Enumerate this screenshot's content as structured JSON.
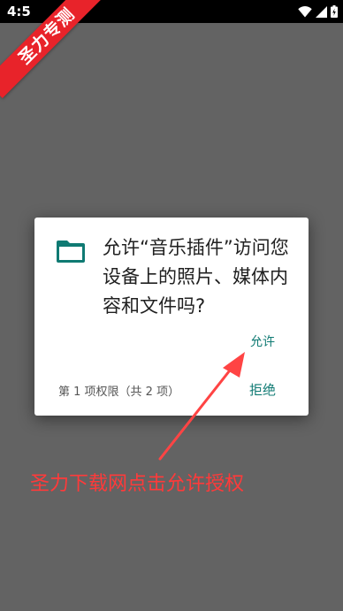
{
  "status_bar": {
    "time": "4:5",
    "icons": [
      "wifi-icon",
      "signal-icon",
      "battery-icon"
    ]
  },
  "watermark": {
    "text": "圣力专测",
    "color": "#e8232a"
  },
  "dialog": {
    "icon": "folder-icon",
    "icon_color": "#0f7a73",
    "title": "允许“音乐插件”访问您设备上的照片、媒体内容和文件吗?",
    "allow_label": "允许",
    "deny_label": "拒绝",
    "permission_count": "第 1 项权限（共 2 项）",
    "accent_color": "#0f7a73"
  },
  "annotation": {
    "text": "圣力下载网点击允许授权",
    "color": "#ff3a3a"
  },
  "colors": {
    "scrim": "#636363",
    "status_bar": "#000000"
  }
}
